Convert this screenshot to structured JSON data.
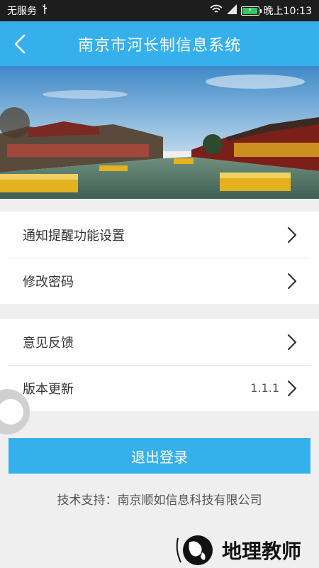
{
  "status_bar": {
    "carrier": "无服务",
    "time": "晚上10:13"
  },
  "header": {
    "title": "南京市河长制信息系统"
  },
  "settings": {
    "group1": [
      {
        "label": "通知提醒功能设置"
      },
      {
        "label": "修改密码"
      }
    ],
    "group2": [
      {
        "label": "意见反馈"
      },
      {
        "label": "版本更新",
        "value": "1.1.1"
      }
    ]
  },
  "actions": {
    "logout_label": "退出登录"
  },
  "footer": {
    "support_text": "技术支持：南京顺如信息科技有限公司"
  },
  "watermark": {
    "text": "地理教师"
  },
  "colors": {
    "primary": "#35b0ec",
    "status_bar": "#1d1d1d",
    "background": "#efefef"
  }
}
